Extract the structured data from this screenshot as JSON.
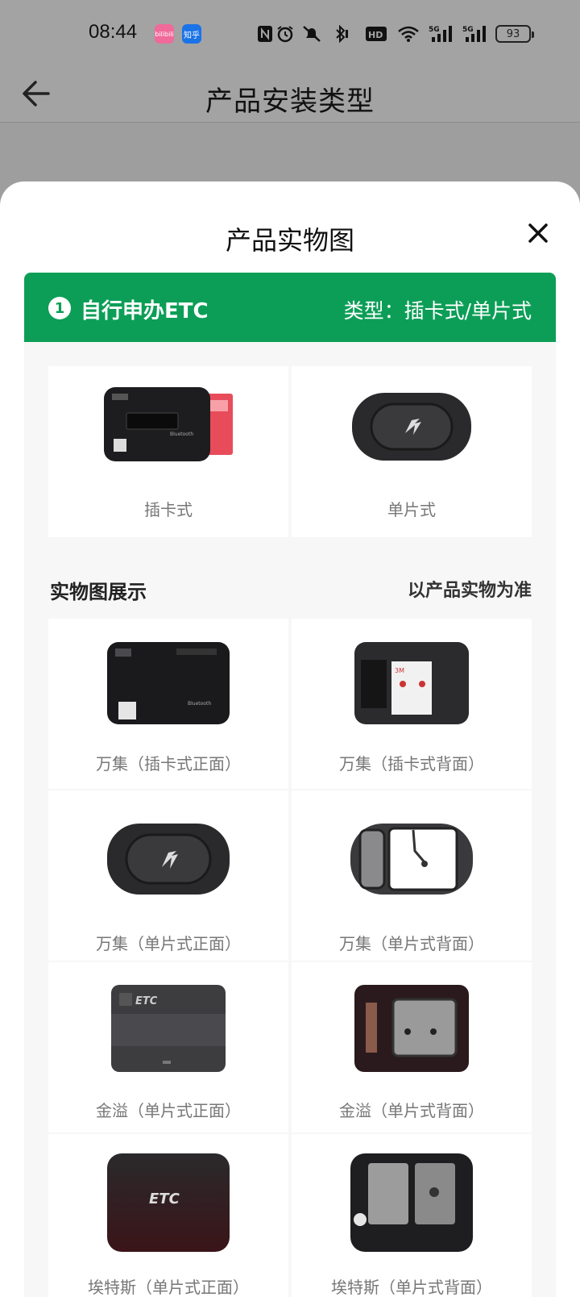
{
  "status_bar": {
    "time": "08:44",
    "apps": [
      {
        "icon": "bilibili-icon",
        "label": "bilibili"
      },
      {
        "icon": "zhihu-icon",
        "label": "知乎"
      }
    ],
    "icons": [
      "nfc-icon",
      "alarm-icon",
      "mute-icon",
      "bluetooth-icon",
      "hd-icon",
      "wifi-icon",
      "signal-5g-icon",
      "signal-5g-icon"
    ],
    "battery": "93"
  },
  "header": {
    "title": "产品安装类型",
    "back_icon": "arrow-left-icon"
  },
  "sheet": {
    "title": "产品实物图",
    "close_icon": "close-icon",
    "banner": {
      "step": "1",
      "left_text": "自行申办ETC",
      "right_text": "类型：插卡式/单片式",
      "color": "#0c9e57"
    },
    "type_cards": [
      {
        "caption": "插卡式",
        "image": "card-slot-etc-device-image"
      },
      {
        "caption": "单片式",
        "image": "single-piece-etc-device-image"
      }
    ],
    "section": {
      "left": "实物图展示",
      "right": "以产品实物为准"
    },
    "gallery": [
      {
        "caption": "万集（插卡式正面）",
        "image": "wanji-card-front-image"
      },
      {
        "caption": "万集（插卡式背面）",
        "image": "wanji-card-back-image"
      },
      {
        "caption": "万集（单片式正面）",
        "image": "wanji-single-front-image"
      },
      {
        "caption": "万集（单片式背面）",
        "image": "wanji-single-back-image"
      },
      {
        "caption": "金溢（单片式正面）",
        "image": "jinyi-single-front-image"
      },
      {
        "caption": "金溢（单片式背面）",
        "image": "jinyi-single-back-image"
      },
      {
        "caption": "埃特斯（单片式正面）",
        "image": "aitesi-single-front-image"
      },
      {
        "caption": "埃特斯（单片式背面）",
        "image": "aitesi-single-back-image"
      }
    ],
    "device_labels": {
      "etc": "ETC"
    }
  }
}
